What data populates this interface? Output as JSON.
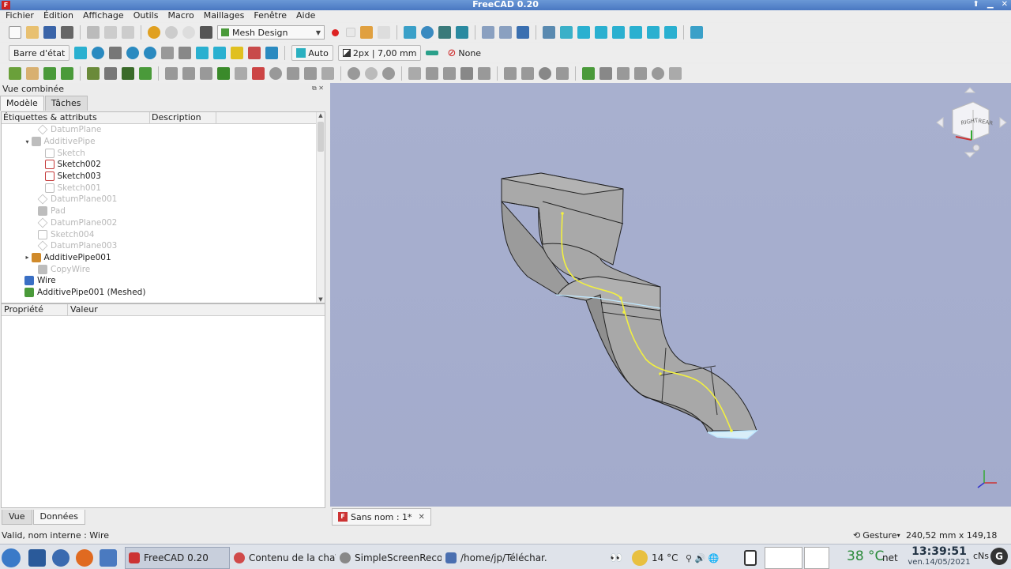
{
  "window": {
    "title": "FreeCAD 0.20",
    "app_icon": "F"
  },
  "menu": [
    "Fichier",
    "Édition",
    "Affichage",
    "Outils",
    "Macro",
    "Maillages",
    "Fenêtre",
    "Aide"
  ],
  "toolbar1": {
    "workbench": "Mesh Design"
  },
  "toolbar2": {
    "statusbar_label": "Barre d'état",
    "auto_label": "Auto",
    "linewidth_label": "2px | 7,00 mm",
    "none_label": "None"
  },
  "combo_view": {
    "title": "Vue combinée",
    "tabs": [
      "Modèle",
      "Tâches"
    ],
    "tree_headers": [
      "Étiquettes & attributs",
      "Description"
    ],
    "tree_items": [
      {
        "label": "DatumPlane",
        "indent": 4,
        "dim": true,
        "icon": "datum-plane-icon",
        "color": "#bdbdbd"
      },
      {
        "label": "AdditivePipe",
        "indent": 3,
        "dim": true,
        "expander": "▾",
        "icon": "additive-pipe-icon",
        "color": "#bdbdbd"
      },
      {
        "label": "Sketch",
        "indent": 5,
        "dim": true,
        "icon": "sketch-icon",
        "color": "#bdbdbd"
      },
      {
        "label": "Sketch002",
        "indent": 5,
        "dim": false,
        "icon": "sketch-icon",
        "color": "#c43a3a"
      },
      {
        "label": "Sketch003",
        "indent": 5,
        "dim": false,
        "icon": "sketch-icon",
        "color": "#c43a3a"
      },
      {
        "label": "Sketch001",
        "indent": 5,
        "dim": true,
        "icon": "sketch-icon",
        "color": "#bdbdbd"
      },
      {
        "label": "DatumPlane001",
        "indent": 4,
        "dim": true,
        "icon": "datum-plane-icon",
        "color": "#bdbdbd"
      },
      {
        "label": "Pad",
        "indent": 4,
        "dim": true,
        "icon": "pad-icon",
        "color": "#bdbdbd"
      },
      {
        "label": "DatumPlane002",
        "indent": 4,
        "dim": true,
        "icon": "datum-plane-icon",
        "color": "#bdbdbd"
      },
      {
        "label": "Sketch004",
        "indent": 4,
        "dim": true,
        "icon": "sketch-icon",
        "color": "#bdbdbd"
      },
      {
        "label": "DatumPlane003",
        "indent": 4,
        "dim": true,
        "icon": "datum-plane-icon",
        "color": "#bdbdbd"
      },
      {
        "label": "AdditivePipe001",
        "indent": 3,
        "dim": false,
        "expander": "▸",
        "icon": "additive-pipe-icon",
        "color": "#d08a2a"
      },
      {
        "label": "CopyWire",
        "indent": 4,
        "dim": true,
        "icon": "copy-wire-icon",
        "color": "#bdbdbd"
      },
      {
        "label": "Wire",
        "indent": 2,
        "dim": false,
        "icon": "wire-icon",
        "color": "#3a6fc4"
      },
      {
        "label": "AdditivePipe001 (Meshed)",
        "indent": 2,
        "dim": false,
        "icon": "mesh-icon",
        "color": "#4a9a3a"
      }
    ],
    "prop_headers": [
      "Propriété",
      "Valeur"
    ],
    "bottom_tabs": [
      "Vue",
      "Données"
    ]
  },
  "navcube": {
    "face_left": "RIGHT",
    "face_right": "REAR"
  },
  "document_tab": {
    "label": "Sans nom : 1*",
    "close": "✕"
  },
  "statusbar": {
    "message": "Valid, nom interne : Wire",
    "nav_style": "Gesture",
    "dimensions": "240,52 mm x 149,18 mm"
  },
  "taskbar": {
    "items": [
      {
        "label": "FreeCAD 0.20",
        "icon_color": "#c33"
      },
      {
        "label": "Contenu de la chaî...",
        "icon_color": "#d04a4a"
      },
      {
        "label": "SimpleScreenReco...",
        "icon_color": "#888"
      },
      {
        "label": "/home/jp/Téléchar...",
        "icon_color": "#4a6fb0"
      }
    ],
    "weather_temp": "14 °C",
    "cpu_temp": "38 °C",
    "net_label": "net",
    "time": "13:39:51",
    "date": "ven.14/05/2021",
    "keyboard": "cNs"
  },
  "colors": {
    "view_bg": "#a6aece",
    "path": "#f2f040",
    "highlight": "#bfe8ff",
    "solid": "#a4a4a4"
  }
}
